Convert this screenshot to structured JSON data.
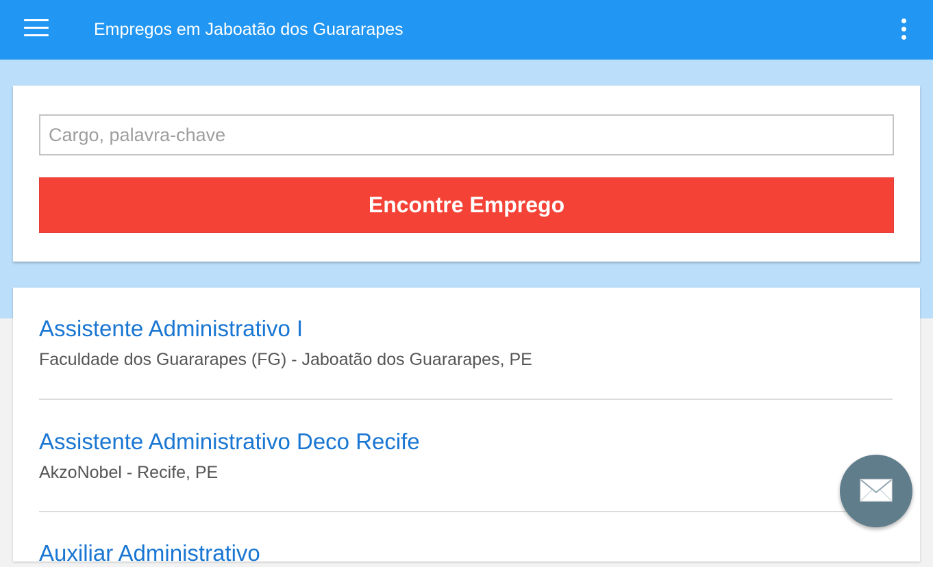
{
  "appbar": {
    "title": "Empregos em Jaboatão dos Guararapes",
    "menu_icon": "hamburger-menu-icon",
    "overflow_icon": "more-vert-icon"
  },
  "search": {
    "placeholder": "Cargo, palavra-chave",
    "value": "",
    "button_label": "Encontre Emprego"
  },
  "jobs": [
    {
      "title": "Assistente Administrativo I",
      "meta": "Faculdade dos Guararapes (FG) - Jaboatão dos Guararapes, PE"
    },
    {
      "title": "Assistente Administrativo Deco Recife",
      "meta": "AkzoNobel - Recife, PE"
    },
    {
      "title": "Auxiliar Administrativo",
      "meta": ""
    }
  ],
  "fab": {
    "icon": "mail-icon"
  },
  "colors": {
    "appbar": "#2196f3",
    "hero_background": "#bbdefb",
    "search_button": "#f44336",
    "job_title": "#1976d2",
    "fab": "#607d8b"
  }
}
